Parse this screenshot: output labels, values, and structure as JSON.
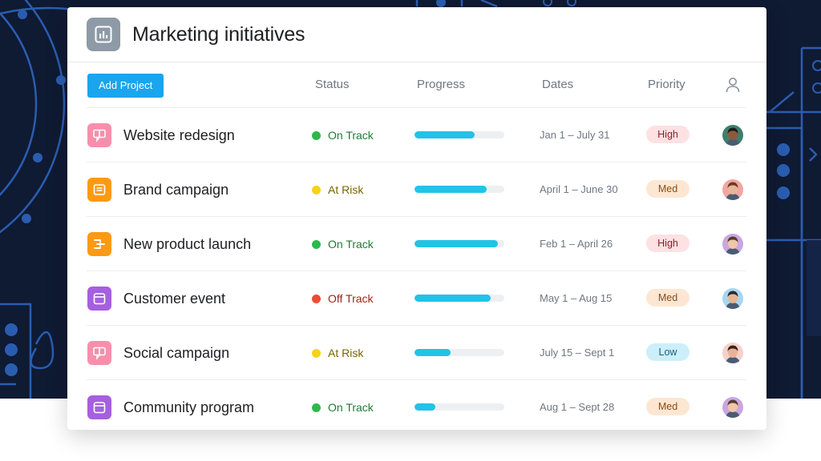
{
  "header": {
    "title": "Marketing initiatives",
    "icon": "chart-icon"
  },
  "toolbar": {
    "add_label": "Add Project"
  },
  "columns": {
    "status": "Status",
    "progress": "Progress",
    "dates": "Dates",
    "priority": "Priority",
    "assignee_icon": "person-icon"
  },
  "colors": {
    "accent": "#1aa5ee",
    "on_track": "#2db84b",
    "at_risk": "#f5d316",
    "off_track": "#ef4b32",
    "progress_fill": "#22c3e6"
  },
  "rows": [
    {
      "name": "Website redesign",
      "icon": "feedback-icon",
      "icon_color": "#f78fab",
      "status": "On Track",
      "status_color": "#2db84b",
      "status_text_color": "#1f7a36",
      "progress": 0.67,
      "dates": "Jan 1 – July 31",
      "priority": "High",
      "priority_bg": "#fde1e3",
      "priority_fg": "#8e1d2b",
      "avatar_skin": "#8d5a3b",
      "avatar_hair": "#1c1c1c",
      "avatar_bg": "#3f7f6d"
    },
    {
      "name": "Brand campaign",
      "icon": "document-icon",
      "icon_color": "#fd9a12",
      "status": "At Risk",
      "status_color": "#f5d316",
      "status_text_color": "#7a6400",
      "progress": 0.8,
      "dates": "April 1 – June 30",
      "priority": "Med",
      "priority_bg": "#fde7d2",
      "priority_fg": "#8a4a12",
      "avatar_skin": "#e8b59a",
      "avatar_hair": "#6b3a24",
      "avatar_bg": "#f1a7a1"
    },
    {
      "name": "New product launch",
      "icon": "roadmap-icon",
      "icon_color": "#fd9a12",
      "status": "On Track",
      "status_color": "#2db84b",
      "status_text_color": "#1f7a36",
      "progress": 0.93,
      "dates": "Feb 1 – April 26",
      "priority": "High",
      "priority_bg": "#fde1e3",
      "priority_fg": "#8e1d2b",
      "avatar_skin": "#f0c7a8",
      "avatar_hair": "#5a3a2a",
      "avatar_bg": "#c9a6e0"
    },
    {
      "name": "Customer event",
      "icon": "calendar-icon",
      "icon_color": "#a65fdf",
      "status": "Off Track",
      "status_color": "#ef4b32",
      "status_text_color": "#9a2617",
      "progress": 0.85,
      "dates": "May 1 – Aug 15",
      "priority": "Med",
      "priority_bg": "#fde7d2",
      "priority_fg": "#8a4a12",
      "avatar_skin": "#e7b594",
      "avatar_hair": "#2a2a2a",
      "avatar_bg": "#a8d6f0"
    },
    {
      "name": "Social campaign",
      "icon": "feedback-icon",
      "icon_color": "#f78fab",
      "status": "At Risk",
      "status_color": "#f5d316",
      "status_text_color": "#7a6400",
      "progress": 0.4,
      "dates": "July 15 – Sept 1",
      "priority": "Low",
      "priority_bg": "#cdeefb",
      "priority_fg": "#1b5f7e",
      "avatar_skin": "#e9b29a",
      "avatar_hair": "#3b2216",
      "avatar_bg": "#f6d1cb"
    },
    {
      "name": "Community program",
      "icon": "calendar-icon",
      "icon_color": "#a65fdf",
      "status": "On Track",
      "status_color": "#2db84b",
      "status_text_color": "#1f7a36",
      "progress": 0.23,
      "dates": "Aug 1 – Sept 28",
      "priority": "Med",
      "priority_bg": "#fde7d2",
      "priority_fg": "#8a4a12",
      "avatar_skin": "#f0c7a8",
      "avatar_hair": "#5a3a2a",
      "avatar_bg": "#c9a6e0"
    }
  ]
}
